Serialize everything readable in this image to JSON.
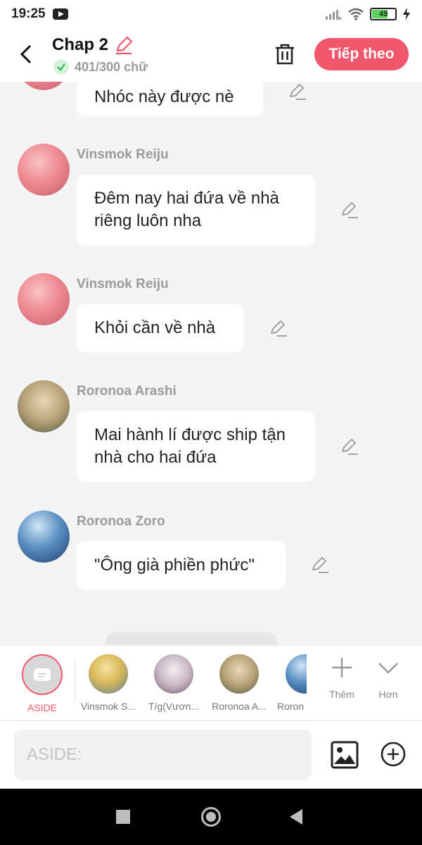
{
  "status": {
    "time": "19:25",
    "battery": "49"
  },
  "header": {
    "title": "Chap 2",
    "count": "401/300 chữ",
    "next_label": "Tiếp theo"
  },
  "messages": [
    {
      "name": "",
      "text": "Nhóc này được nè"
    },
    {
      "name": "Vinsmok Reiju",
      "text": "Đêm nay hai đứa về nhà riêng luôn nha"
    },
    {
      "name": "Vinsmok Reiju",
      "text": "Khỏi cần về nhà"
    },
    {
      "name": "Roronoa Arashi",
      "text": "Mai hành lí được ship tận nhà cho hai đứa"
    },
    {
      "name": "Roronoa Zoro",
      "text": "\"Ông già phiền phức\""
    }
  ],
  "characters": [
    {
      "label": "ASIDE"
    },
    {
      "label": "Vinsmok S..."
    },
    {
      "label": "T/g(Vươn..."
    },
    {
      "label": "Roronoa A..."
    },
    {
      "label": "Roron"
    }
  ],
  "more": {
    "add_label": "Thêm",
    "more_label": "Hơn"
  },
  "input": {
    "placeholder": "ASIDE:"
  },
  "colors": {
    "accent": "#f0566c",
    "background": "#f4f4f4"
  }
}
